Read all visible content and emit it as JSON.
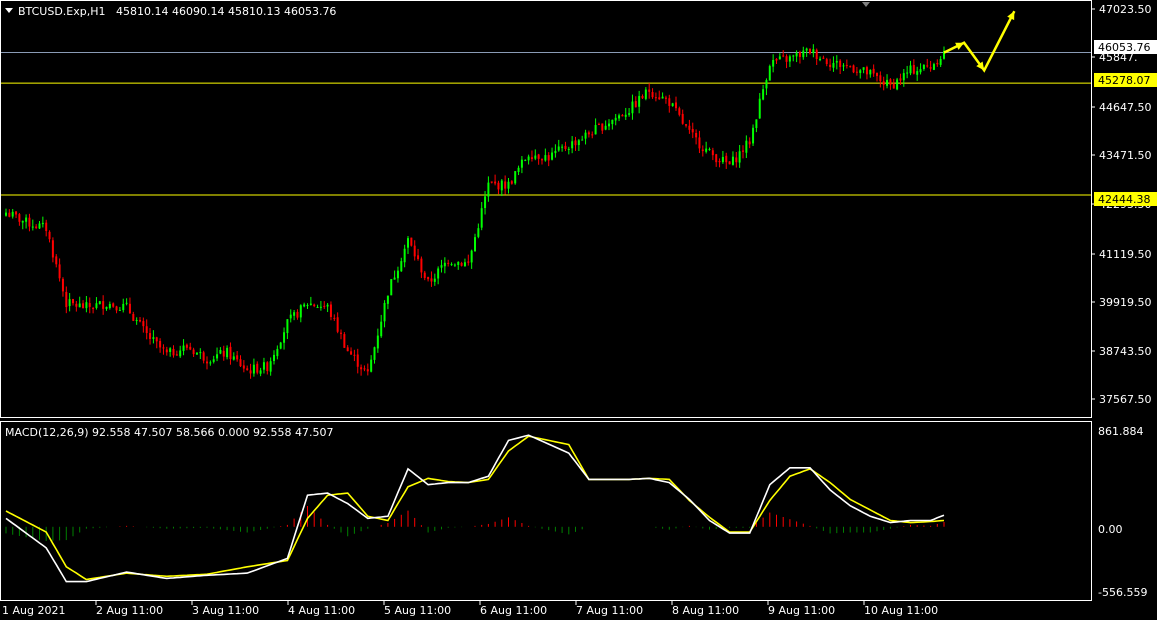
{
  "header": {
    "symbol": "BTCUSD.Exp,H1",
    "ohlc": "45810.14 46090.14 45810.13 46053.76"
  },
  "colors": {
    "background": "#000000",
    "bull": "#00ff00",
    "bear": "#ff0000",
    "level_line": "#ffff00",
    "price_line": "#8a9bb5",
    "signal": "#ffff00",
    "macd_line": "#ffffff",
    "hist_pos": "#ff0000",
    "hist_neg": "#008000",
    "frame": "#ffffff"
  },
  "price_axis": {
    "ticks": [
      "47023.50",
      "45847.",
      "44647.50",
      "43471.50",
      "42295.50",
      "41119.50",
      "39919.50",
      "38743.50",
      "37567.50"
    ],
    "range": [
      37250,
      47180
    ]
  },
  "price_labels": {
    "current": "46053.76",
    "resistance": "45278.07",
    "support": "42444.38"
  },
  "macd": {
    "label": "MACD(12,26,9) 92.558 47.507 58.566 0.000 92.558 47.507",
    "ticks": [
      "861.884",
      "0.00",
      "-556.559"
    ],
    "range": [
      -600,
      900
    ]
  },
  "time_axis": {
    "labels": [
      "1 Aug 2021",
      "2 Aug 11:00",
      "3 Aug 11:00",
      "4 Aug 11:00",
      "5 Aug 11:00",
      "6 Aug 11:00",
      "7 Aug 11:00",
      "8 Aug 11:00",
      "9 Aug 11:00",
      "10 Aug 11:00"
    ]
  },
  "chart_data": {
    "type": "candlestick",
    "timeframe": "H1",
    "levels": {
      "current": 46053.76,
      "resistance": 45278.07,
      "support": 42444.38
    },
    "close_path": [
      [
        0,
        42000
      ],
      [
        6,
        41750
      ],
      [
        12,
        41600
      ],
      [
        18,
        39700
      ],
      [
        24,
        39600
      ],
      [
        30,
        39700
      ],
      [
        36,
        39600
      ],
      [
        42,
        38900
      ],
      [
        48,
        38400
      ],
      [
        54,
        38600
      ],
      [
        60,
        38300
      ],
      [
        66,
        38450
      ],
      [
        72,
        38000
      ],
      [
        78,
        38100
      ],
      [
        84,
        39200
      ],
      [
        90,
        39700
      ],
      [
        96,
        39600
      ],
      [
        102,
        38500
      ],
      [
        108,
        37900
      ],
      [
        114,
        40000
      ],
      [
        120,
        41300
      ],
      [
        126,
        40200
      ],
      [
        132,
        40800
      ],
      [
        138,
        40700
      ],
      [
        144,
        42700
      ],
      [
        150,
        42700
      ],
      [
        156,
        43500
      ],
      [
        162,
        43400
      ],
      [
        168,
        43700
      ],
      [
        174,
        44000
      ],
      [
        180,
        44300
      ],
      [
        186,
        44600
      ],
      [
        192,
        45100
      ],
      [
        198,
        44800
      ],
      [
        204,
        44000
      ],
      [
        210,
        43500
      ],
      [
        216,
        43200
      ],
      [
        222,
        43800
      ],
      [
        228,
        45800
      ],
      [
        234,
        45900
      ],
      [
        240,
        46100
      ],
      [
        246,
        45800
      ],
      [
        252,
        45700
      ],
      [
        258,
        45500
      ],
      [
        264,
        45200
      ],
      [
        270,
        45600
      ],
      [
        276,
        45700
      ],
      [
        280,
        46050
      ]
    ],
    "forecast_arrow": [
      [
        280,
        46050
      ],
      [
        286,
        46300
      ],
      [
        292,
        45600
      ],
      [
        301,
        47100
      ]
    ],
    "macd_path": [
      [
        0,
        80
      ],
      [
        12,
        -200
      ],
      [
        18,
        -520
      ],
      [
        24,
        -520
      ],
      [
        36,
        -430
      ],
      [
        48,
        -490
      ],
      [
        60,
        -460
      ],
      [
        72,
        -440
      ],
      [
        84,
        -300
      ],
      [
        90,
        300
      ],
      [
        96,
        320
      ],
      [
        102,
        220
      ],
      [
        108,
        80
      ],
      [
        114,
        100
      ],
      [
        120,
        550
      ],
      [
        126,
        400
      ],
      [
        132,
        420
      ],
      [
        138,
        420
      ],
      [
        144,
        480
      ],
      [
        150,
        820
      ],
      [
        156,
        870
      ],
      [
        168,
        700
      ],
      [
        174,
        450
      ],
      [
        186,
        450
      ],
      [
        192,
        460
      ],
      [
        198,
        420
      ],
      [
        204,
        260
      ],
      [
        210,
        60
      ],
      [
        216,
        -60
      ],
      [
        222,
        -60
      ],
      [
        228,
        400
      ],
      [
        234,
        560
      ],
      [
        240,
        560
      ],
      [
        246,
        350
      ],
      [
        252,
        200
      ],
      [
        258,
        100
      ],
      [
        264,
        40
      ],
      [
        270,
        60
      ],
      [
        276,
        60
      ],
      [
        280,
        110
      ]
    ],
    "signal_path": [
      [
        0,
        150
      ],
      [
        12,
        -50
      ],
      [
        18,
        -380
      ],
      [
        24,
        -500
      ],
      [
        36,
        -440
      ],
      [
        48,
        -470
      ],
      [
        60,
        -450
      ],
      [
        72,
        -380
      ],
      [
        84,
        -320
      ],
      [
        90,
        80
      ],
      [
        96,
        300
      ],
      [
        102,
        320
      ],
      [
        108,
        100
      ],
      [
        114,
        60
      ],
      [
        120,
        380
      ],
      [
        126,
        460
      ],
      [
        132,
        430
      ],
      [
        138,
        420
      ],
      [
        144,
        450
      ],
      [
        150,
        720
      ],
      [
        156,
        860
      ],
      [
        168,
        780
      ],
      [
        174,
        450
      ],
      [
        186,
        450
      ],
      [
        192,
        460
      ],
      [
        198,
        450
      ],
      [
        204,
        250
      ],
      [
        210,
        90
      ],
      [
        216,
        -50
      ],
      [
        222,
        -50
      ],
      [
        228,
        250
      ],
      [
        234,
        480
      ],
      [
        240,
        550
      ],
      [
        246,
        420
      ],
      [
        252,
        260
      ],
      [
        258,
        160
      ],
      [
        264,
        60
      ],
      [
        270,
        40
      ],
      [
        276,
        50
      ],
      [
        280,
        60
      ]
    ]
  }
}
